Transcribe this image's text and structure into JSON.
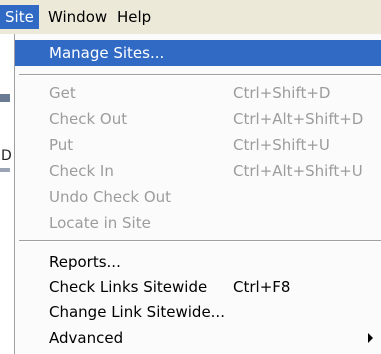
{
  "menubar": {
    "items": [
      "Site",
      "Window",
      "Help"
    ]
  },
  "left_strip": {
    "glyph_d": "D"
  },
  "menu": {
    "group1": [
      "Manage Sites..."
    ],
    "group2": [
      {
        "label": "Get",
        "shortcut": "Ctrl+Shift+D",
        "enabled": false
      },
      {
        "label": "Check Out",
        "shortcut": "Ctrl+Alt+Shift+D",
        "enabled": false
      },
      {
        "label": "Put",
        "shortcut": "Ctrl+Shift+U",
        "enabled": false
      },
      {
        "label": "Check In",
        "shortcut": "Ctrl+Alt+Shift+U",
        "enabled": false
      },
      {
        "label": "Undo Check Out",
        "shortcut": "",
        "enabled": false
      },
      {
        "label": "Locate in Site",
        "shortcut": "",
        "enabled": false
      }
    ],
    "group3": [
      {
        "label": "Reports...",
        "shortcut": ""
      },
      {
        "label": "Check Links Sitewide",
        "shortcut": "Ctrl+F8"
      },
      {
        "label": "Change Link Sitewide...",
        "shortcut": ""
      },
      {
        "label": "Advanced",
        "shortcut": "",
        "submenu": true
      }
    ]
  },
  "colors": {
    "highlight": "#316ac5",
    "disabled_text": "#9c9c9c",
    "menubar_bg": "#ece9d8"
  }
}
